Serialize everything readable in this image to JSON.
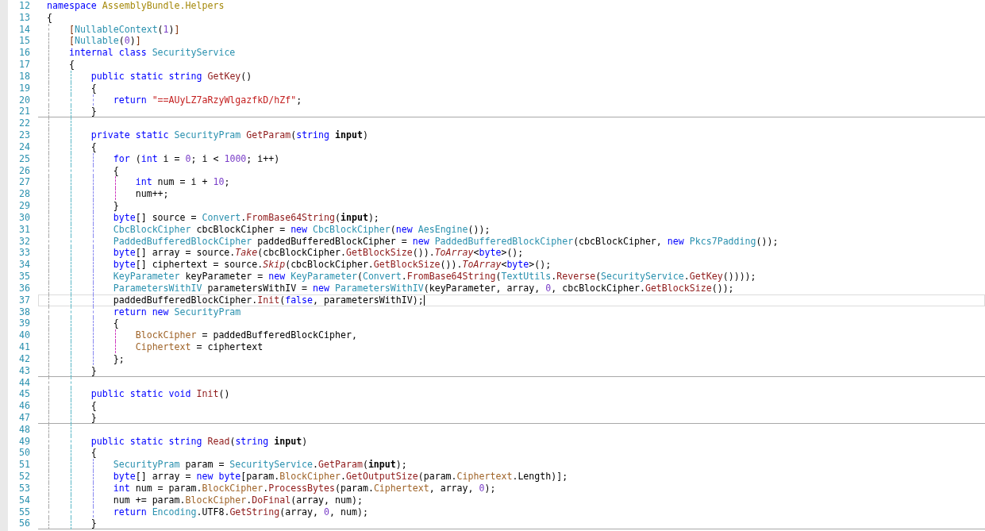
{
  "editor": {
    "lines": [
      {
        "number": "12",
        "current": false,
        "separator_below": false,
        "tokens": [
          {
            "text": "namespace",
            "kind": "kw"
          },
          {
            "text": " AssemblyBundle.Helpers",
            "kind": "ns"
          }
        ]
      },
      {
        "number": "13",
        "current": false,
        "separator_below": false,
        "tokens": [
          {
            "text": "{",
            "kind": "plain"
          }
        ]
      },
      {
        "number": "14",
        "current": false,
        "separator_below": false,
        "tokens": [
          {
            "text": "    [",
            "kind": "bracket"
          },
          {
            "text": "NullableContext",
            "kind": "type"
          },
          {
            "text": "(",
            "kind": "plain"
          },
          {
            "text": "1",
            "kind": "num"
          },
          {
            "text": ")",
            "kind": "plain"
          },
          {
            "text": "]",
            "kind": "bracket"
          }
        ]
      },
      {
        "number": "15",
        "current": false,
        "separator_below": false,
        "tokens": [
          {
            "text": "    [",
            "kind": "bracket"
          },
          {
            "text": "Nullable",
            "kind": "type"
          },
          {
            "text": "(",
            "kind": "plain"
          },
          {
            "text": "0",
            "kind": "num"
          },
          {
            "text": ")",
            "kind": "plain"
          },
          {
            "text": "]",
            "kind": "bracket"
          }
        ]
      },
      {
        "number": "16",
        "current": false,
        "separator_below": false,
        "tokens": [
          {
            "text": "    internal",
            "kind": "kw"
          },
          {
            "text": " class",
            "kind": "kw"
          },
          {
            "text": " SecurityService",
            "kind": "type"
          }
        ]
      },
      {
        "number": "17",
        "current": false,
        "separator_below": false,
        "tokens": [
          {
            "text": "    {",
            "kind": "plain"
          }
        ]
      },
      {
        "number": "18",
        "current": false,
        "separator_below": false,
        "tokens": [
          {
            "text": "        public",
            "kind": "kw"
          },
          {
            "text": " static",
            "kind": "kw"
          },
          {
            "text": " string",
            "kind": "kw"
          },
          {
            "text": " GetKey",
            "kind": "method"
          },
          {
            "text": "()",
            "kind": "plain"
          }
        ]
      },
      {
        "number": "19",
        "current": false,
        "separator_below": false,
        "tokens": [
          {
            "text": "        {",
            "kind": "plain"
          }
        ]
      },
      {
        "number": "20",
        "current": false,
        "separator_below": false,
        "tokens": [
          {
            "text": "            return",
            "kind": "kw"
          },
          {
            "text": " \"==AUyLZ7aRzyWlgazfkD/hZf\"",
            "kind": "string"
          },
          {
            "text": ";",
            "kind": "plain"
          }
        ]
      },
      {
        "number": "21",
        "current": false,
        "separator_below": true,
        "tokens": [
          {
            "text": "        }",
            "kind": "plain"
          }
        ]
      },
      {
        "number": "22",
        "current": false,
        "separator_below": false
      },
      {
        "number": "23",
        "current": false,
        "separator_below": false,
        "tokens": [
          {
            "text": "        private",
            "kind": "kw"
          },
          {
            "text": " static",
            "kind": "kw"
          },
          {
            "text": " SecurityPram",
            "kind": "type"
          },
          {
            "text": " GetParam",
            "kind": "method"
          },
          {
            "text": "(",
            "kind": "plain"
          },
          {
            "text": "string",
            "kind": "kw"
          },
          {
            "text": " input",
            "kind": "param"
          },
          {
            "text": ")",
            "kind": "plain"
          }
        ]
      },
      {
        "number": "24",
        "current": false,
        "separator_below": false,
        "tokens": [
          {
            "text": "        {",
            "kind": "plain"
          }
        ]
      },
      {
        "number": "25",
        "current": false,
        "separator_below": false,
        "tokens": [
          {
            "text": "            for",
            "kind": "kw"
          },
          {
            "text": " (",
            "kind": "plain"
          },
          {
            "text": "int",
            "kind": "kw"
          },
          {
            "text": " i = ",
            "kind": "plain"
          },
          {
            "text": "0",
            "kind": "num"
          },
          {
            "text": "; i < ",
            "kind": "plain"
          },
          {
            "text": "1000",
            "kind": "num"
          },
          {
            "text": "; i++)",
            "kind": "plain"
          }
        ]
      },
      {
        "number": "26",
        "current": false,
        "separator_below": false,
        "tokens": [
          {
            "text": "            {",
            "kind": "plain"
          }
        ]
      },
      {
        "number": "27",
        "current": false,
        "separator_below": false,
        "tokens": [
          {
            "text": "                int",
            "kind": "kw"
          },
          {
            "text": " num = i + ",
            "kind": "plain"
          },
          {
            "text": "10",
            "kind": "num"
          },
          {
            "text": ";",
            "kind": "plain"
          }
        ]
      },
      {
        "number": "28",
        "current": false,
        "separator_below": false,
        "tokens": [
          {
            "text": "                num++;",
            "kind": "plain"
          }
        ]
      },
      {
        "number": "29",
        "current": false,
        "separator_below": false,
        "tokens": [
          {
            "text": "            }",
            "kind": "plain"
          }
        ]
      },
      {
        "number": "30",
        "current": false,
        "separator_below": false,
        "tokens": [
          {
            "text": "            byte",
            "kind": "kw"
          },
          {
            "text": "[] source = ",
            "kind": "plain"
          },
          {
            "text": "Convert",
            "kind": "type"
          },
          {
            "text": ".",
            "kind": "plain"
          },
          {
            "text": "FromBase64String",
            "kind": "method"
          },
          {
            "text": "(",
            "kind": "plain"
          },
          {
            "text": "input",
            "kind": "param"
          },
          {
            "text": ");",
            "kind": "plain"
          }
        ]
      },
      {
        "number": "31",
        "current": false,
        "separator_below": false,
        "tokens": [
          {
            "text": "            CbcBlockCipher",
            "kind": "type"
          },
          {
            "text": " cbcBlockCipher = ",
            "kind": "plain"
          },
          {
            "text": "new",
            "kind": "kw"
          },
          {
            "text": " CbcBlockCipher",
            "kind": "type"
          },
          {
            "text": "(",
            "kind": "plain"
          },
          {
            "text": "new",
            "kind": "kw"
          },
          {
            "text": " AesEngine",
            "kind": "type"
          },
          {
            "text": "());",
            "kind": "plain"
          }
        ]
      },
      {
        "number": "32",
        "current": false,
        "separator_below": false,
        "tokens": [
          {
            "text": "            PaddedBufferedBlockCipher",
            "kind": "type"
          },
          {
            "text": " paddedBufferedBlockCipher = ",
            "kind": "plain"
          },
          {
            "text": "new",
            "kind": "kw"
          },
          {
            "text": " PaddedBufferedBlockCipher",
            "kind": "type"
          },
          {
            "text": "(cbcBlockCipher, ",
            "kind": "plain"
          },
          {
            "text": "new",
            "kind": "kw"
          },
          {
            "text": " Pkcs7Padding",
            "kind": "type"
          },
          {
            "text": "());",
            "kind": "plain"
          }
        ]
      },
      {
        "number": "33",
        "current": false,
        "separator_below": false,
        "tokens": [
          {
            "text": "            byte",
            "kind": "kw"
          },
          {
            "text": "[] array = source.",
            "kind": "plain"
          },
          {
            "text": "Take",
            "kind": "ext"
          },
          {
            "text": "(cbcBlockCipher.",
            "kind": "plain"
          },
          {
            "text": "GetBlockSize",
            "kind": "method"
          },
          {
            "text": "()).",
            "kind": "plain"
          },
          {
            "text": "ToArray",
            "kind": "ext"
          },
          {
            "text": "<",
            "kind": "plain"
          },
          {
            "text": "byte",
            "kind": "kw"
          },
          {
            "text": ">();",
            "kind": "plain"
          }
        ]
      },
      {
        "number": "34",
        "current": false,
        "separator_below": false,
        "tokens": [
          {
            "text": "            byte",
            "kind": "kw"
          },
          {
            "text": "[] ciphertext = source.",
            "kind": "plain"
          },
          {
            "text": "Skip",
            "kind": "ext"
          },
          {
            "text": "(cbcBlockCipher.",
            "kind": "plain"
          },
          {
            "text": "GetBlockSize",
            "kind": "method"
          },
          {
            "text": "()).",
            "kind": "plain"
          },
          {
            "text": "ToArray",
            "kind": "ext"
          },
          {
            "text": "<",
            "kind": "plain"
          },
          {
            "text": "byte",
            "kind": "kw"
          },
          {
            "text": ">();",
            "kind": "plain"
          }
        ]
      },
      {
        "number": "35",
        "current": false,
        "separator_below": false,
        "tokens": [
          {
            "text": "            KeyParameter",
            "kind": "type"
          },
          {
            "text": " keyParameter = ",
            "kind": "plain"
          },
          {
            "text": "new",
            "kind": "kw"
          },
          {
            "text": " KeyParameter",
            "kind": "type"
          },
          {
            "text": "(",
            "kind": "plain"
          },
          {
            "text": "Convert",
            "kind": "type"
          },
          {
            "text": ".",
            "kind": "plain"
          },
          {
            "text": "FromBase64String",
            "kind": "method"
          },
          {
            "text": "(",
            "kind": "plain"
          },
          {
            "text": "TextUtils",
            "kind": "type"
          },
          {
            "text": ".",
            "kind": "plain"
          },
          {
            "text": "Reverse",
            "kind": "method"
          },
          {
            "text": "(",
            "kind": "plain"
          },
          {
            "text": "SecurityService",
            "kind": "type"
          },
          {
            "text": ".",
            "kind": "plain"
          },
          {
            "text": "GetKey",
            "kind": "method"
          },
          {
            "text": "())));",
            "kind": "plain"
          }
        ]
      },
      {
        "number": "36",
        "current": false,
        "separator_below": false,
        "tokens": [
          {
            "text": "            ParametersWithIV",
            "kind": "type"
          },
          {
            "text": " parametersWithIV = ",
            "kind": "plain"
          },
          {
            "text": "new",
            "kind": "kw"
          },
          {
            "text": " ParametersWithIV",
            "kind": "type"
          },
          {
            "text": "(keyParameter, array, ",
            "kind": "plain"
          },
          {
            "text": "0",
            "kind": "num"
          },
          {
            "text": ", cbcBlockCipher.",
            "kind": "plain"
          },
          {
            "text": "GetBlockSize",
            "kind": "method"
          },
          {
            "text": "());",
            "kind": "plain"
          }
        ]
      },
      {
        "number": "37",
        "current": true,
        "separator_below": false,
        "tokens": [
          {
            "text": "            paddedBufferedBlockCipher.",
            "kind": "plain"
          },
          {
            "text": "Init",
            "kind": "method"
          },
          {
            "text": "(",
            "kind": "plain"
          },
          {
            "text": "false",
            "kind": "kw"
          },
          {
            "text": ", parametersWithIV);",
            "kind": "plain"
          }
        ]
      },
      {
        "number": "38",
        "current": false,
        "separator_below": false,
        "tokens": [
          {
            "text": "            return",
            "kind": "kw"
          },
          {
            "text": " new",
            "kind": "kw"
          },
          {
            "text": " SecurityPram",
            "kind": "type"
          }
        ]
      },
      {
        "number": "39",
        "current": false,
        "separator_below": false,
        "tokens": [
          {
            "text": "            {",
            "kind": "plain"
          }
        ]
      },
      {
        "number": "40",
        "current": false,
        "separator_below": false,
        "tokens": [
          {
            "text": "                BlockCipher",
            "kind": "prop"
          },
          {
            "text": " = paddedBufferedBlockCipher,",
            "kind": "plain"
          }
        ]
      },
      {
        "number": "41",
        "current": false,
        "separator_below": false,
        "tokens": [
          {
            "text": "                Ciphertext",
            "kind": "prop"
          },
          {
            "text": " = ciphertext",
            "kind": "plain"
          }
        ]
      },
      {
        "number": "42",
        "current": false,
        "separator_below": false,
        "tokens": [
          {
            "text": "            };",
            "kind": "plain"
          }
        ]
      },
      {
        "number": "43",
        "current": false,
        "separator_below": true,
        "tokens": [
          {
            "text": "        }",
            "kind": "plain"
          }
        ]
      },
      {
        "number": "44",
        "current": false,
        "separator_below": false
      },
      {
        "number": "45",
        "current": false,
        "separator_below": false,
        "tokens": [
          {
            "text": "        public",
            "kind": "kw"
          },
          {
            "text": " static",
            "kind": "kw"
          },
          {
            "text": " void",
            "kind": "kw"
          },
          {
            "text": " Init",
            "kind": "method"
          },
          {
            "text": "()",
            "kind": "plain"
          }
        ]
      },
      {
        "number": "46",
        "current": false,
        "separator_below": false,
        "tokens": [
          {
            "text": "        {",
            "kind": "plain"
          }
        ]
      },
      {
        "number": "47",
        "current": false,
        "separator_below": true,
        "tokens": [
          {
            "text": "        }",
            "kind": "plain"
          }
        ]
      },
      {
        "number": "48",
        "current": false,
        "separator_below": false
      },
      {
        "number": "49",
        "current": false,
        "separator_below": false,
        "tokens": [
          {
            "text": "        public",
            "kind": "kw"
          },
          {
            "text": " static",
            "kind": "kw"
          },
          {
            "text": " string",
            "kind": "kw"
          },
          {
            "text": " Read",
            "kind": "method"
          },
          {
            "text": "(",
            "kind": "plain"
          },
          {
            "text": "string",
            "kind": "kw"
          },
          {
            "text": " input",
            "kind": "param"
          },
          {
            "text": ")",
            "kind": "plain"
          }
        ]
      },
      {
        "number": "50",
        "current": false,
        "separator_below": false,
        "tokens": [
          {
            "text": "        {",
            "kind": "plain"
          }
        ]
      },
      {
        "number": "51",
        "current": false,
        "separator_below": false,
        "tokens": [
          {
            "text": "            SecurityPram",
            "kind": "type"
          },
          {
            "text": " param = ",
            "kind": "plain"
          },
          {
            "text": "SecurityService",
            "kind": "type"
          },
          {
            "text": ".",
            "kind": "plain"
          },
          {
            "text": "GetParam",
            "kind": "method"
          },
          {
            "text": "(",
            "kind": "plain"
          },
          {
            "text": "input",
            "kind": "param"
          },
          {
            "text": ");",
            "kind": "plain"
          }
        ]
      },
      {
        "number": "52",
        "current": false,
        "separator_below": false,
        "tokens": [
          {
            "text": "            byte",
            "kind": "kw"
          },
          {
            "text": "[] array = ",
            "kind": "plain"
          },
          {
            "text": "new",
            "kind": "kw"
          },
          {
            "text": " byte",
            "kind": "kw"
          },
          {
            "text": "[param.",
            "kind": "plain"
          },
          {
            "text": "BlockCipher",
            "kind": "prop"
          },
          {
            "text": ".",
            "kind": "plain"
          },
          {
            "text": "GetOutputSize",
            "kind": "method"
          },
          {
            "text": "(param.",
            "kind": "plain"
          },
          {
            "text": "Ciphertext",
            "kind": "prop"
          },
          {
            "text": ".Length)];",
            "kind": "plain"
          }
        ]
      },
      {
        "number": "53",
        "current": false,
        "separator_below": false,
        "tokens": [
          {
            "text": "            int",
            "kind": "kw"
          },
          {
            "text": " num = param.",
            "kind": "plain"
          },
          {
            "text": "BlockCipher",
            "kind": "prop"
          },
          {
            "text": ".",
            "kind": "plain"
          },
          {
            "text": "ProcessBytes",
            "kind": "method"
          },
          {
            "text": "(param.",
            "kind": "plain"
          },
          {
            "text": "Ciphertext",
            "kind": "prop"
          },
          {
            "text": ", array, ",
            "kind": "plain"
          },
          {
            "text": "0",
            "kind": "num"
          },
          {
            "text": ");",
            "kind": "plain"
          }
        ]
      },
      {
        "number": "54",
        "current": false,
        "separator_below": false,
        "tokens": [
          {
            "text": "            num += param.",
            "kind": "plain"
          },
          {
            "text": "BlockCipher",
            "kind": "prop"
          },
          {
            "text": ".",
            "kind": "plain"
          },
          {
            "text": "DoFinal",
            "kind": "method"
          },
          {
            "text": "(array, num);",
            "kind": "plain"
          }
        ]
      },
      {
        "number": "55",
        "current": false,
        "separator_below": false,
        "tokens": [
          {
            "text": "            return",
            "kind": "kw"
          },
          {
            "text": " Encoding",
            "kind": "type"
          },
          {
            "text": ".UTF8.",
            "kind": "plain"
          },
          {
            "text": "GetString",
            "kind": "method"
          },
          {
            "text": "(array, ",
            "kind": "plain"
          },
          {
            "text": "0",
            "kind": "num"
          },
          {
            "text": ", num);",
            "kind": "plain"
          }
        ]
      },
      {
        "number": "56",
        "current": false,
        "separator_below": true,
        "tokens": [
          {
            "text": "        }",
            "kind": "plain"
          }
        ]
      }
    ]
  }
}
